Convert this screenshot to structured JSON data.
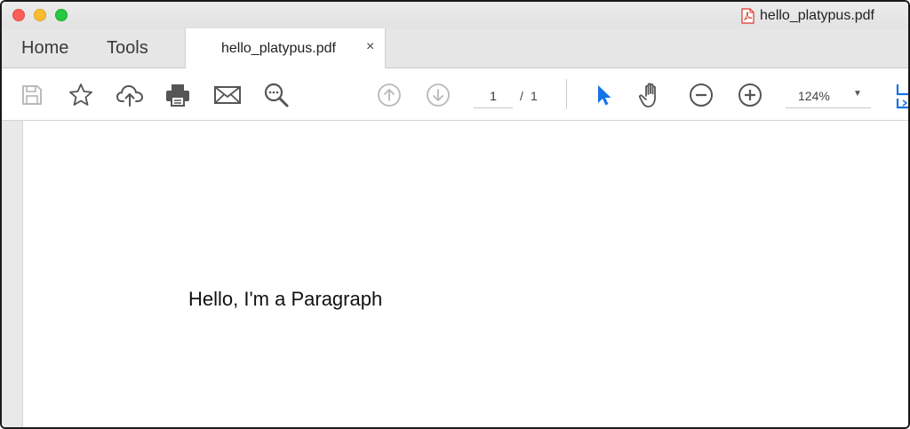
{
  "window": {
    "title": "hello_platypus.pdf"
  },
  "nav_tabs": {
    "home": "Home",
    "tools": "Tools"
  },
  "document_tab": {
    "label": "hello_platypus.pdf",
    "close_glyph": "×"
  },
  "toolbar": {
    "icons": [
      "save-icon",
      "star-icon",
      "cloud-upload-icon",
      "print-icon",
      "mail-icon",
      "search-zoom-icon",
      "page-up-icon",
      "page-down-icon",
      "select-cursor-icon",
      "hand-icon",
      "zoom-out-icon",
      "zoom-in-icon",
      "fit-page-icon"
    ],
    "page_current": "1",
    "page_separator": "/",
    "page_total": "1",
    "zoom_level": "124%",
    "zoom_caret": "▼"
  },
  "document": {
    "paragraph": "Hello, I'm a Paragraph"
  },
  "colors": {
    "accent": "#1473e6",
    "traffic_close": "#fc5f57",
    "traffic_minimize": "#fdbc2e",
    "traffic_zoom": "#28c840",
    "pdf_icon_red": "#d8342c"
  }
}
